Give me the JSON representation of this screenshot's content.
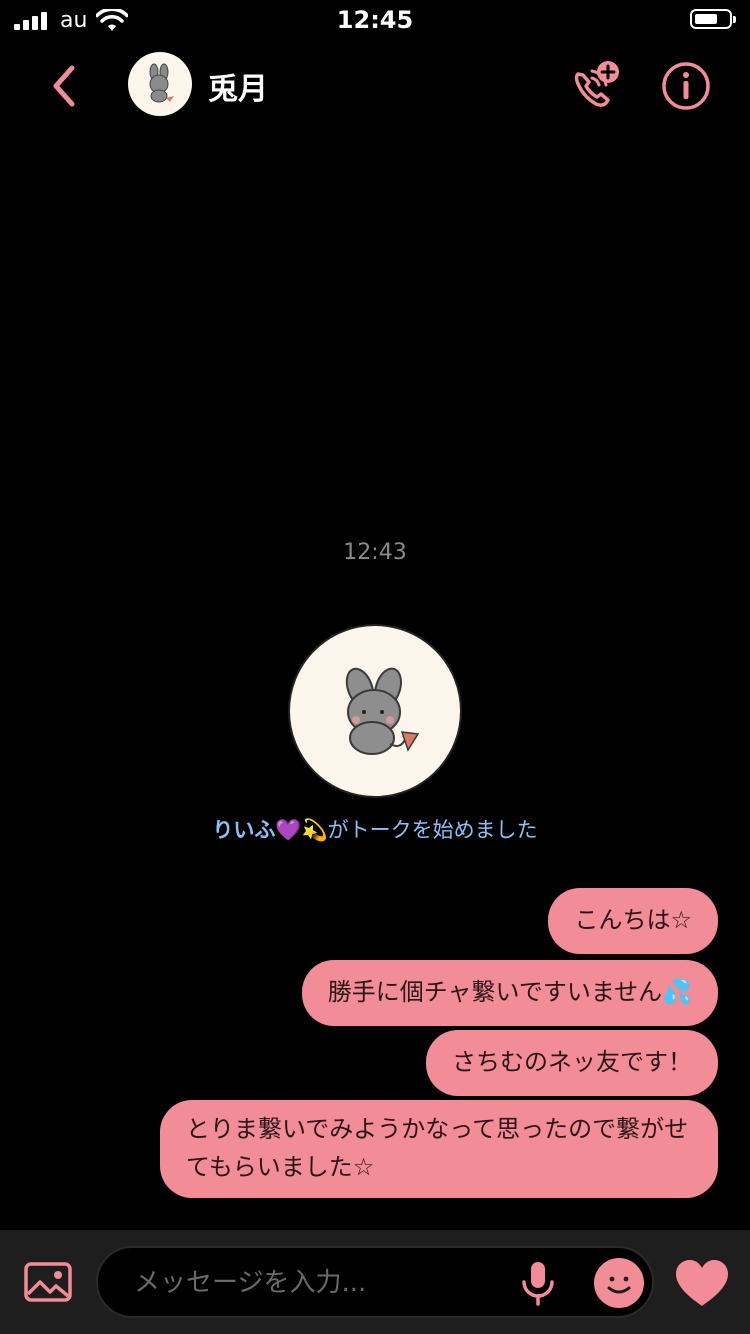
{
  "status_bar": {
    "carrier": "au",
    "time": "12:45",
    "icons": [
      "signal-icon",
      "wifi-icon",
      "battery-icon"
    ]
  },
  "header": {
    "contact_name": "兎月",
    "icons": [
      "back-chevron-icon",
      "bunny-avatar",
      "add-call-icon",
      "info-icon"
    ]
  },
  "chat": {
    "timestamp": "12:43",
    "system_message": {
      "user": "りいふ💜💫",
      "text": "がトークを始めました"
    },
    "messages": [
      "こんちは☆",
      "勝手に個チャ繋いですいません💦",
      "さちむのネッ友です！",
      "とりま繋いでみようかなって思ったので繋がせてもらいました☆"
    ]
  },
  "input_bar": {
    "placeholder": "メッセージを入力...",
    "icons": [
      "image-icon",
      "mic-icon",
      "emoji-icon",
      "heart-icon"
    ]
  },
  "colors": {
    "accent": "#f28c96",
    "background": "#000000",
    "bubble_text": "#2a1518",
    "system_text": "#8cc0f5",
    "timestamp": "#8a8a8a"
  }
}
